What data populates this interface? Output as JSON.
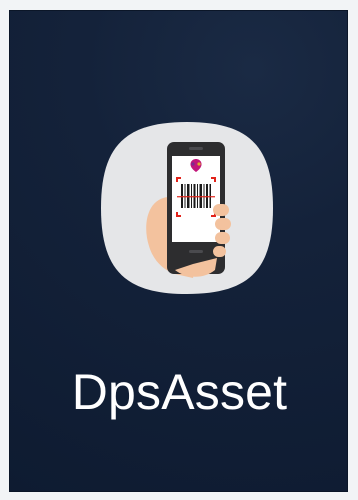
{
  "app": {
    "name": "DpsAsset",
    "icon": "barcode-scanner-phone-icon"
  },
  "colors": {
    "panel_background": "#0e1b31",
    "icon_background": "#e5e6e8",
    "label": "#ffffff",
    "phone_body": "#2d2d2f",
    "hand": "#f3c29e",
    "scan_corner": "#e2231a",
    "logo_magenta": "#c2177a"
  }
}
